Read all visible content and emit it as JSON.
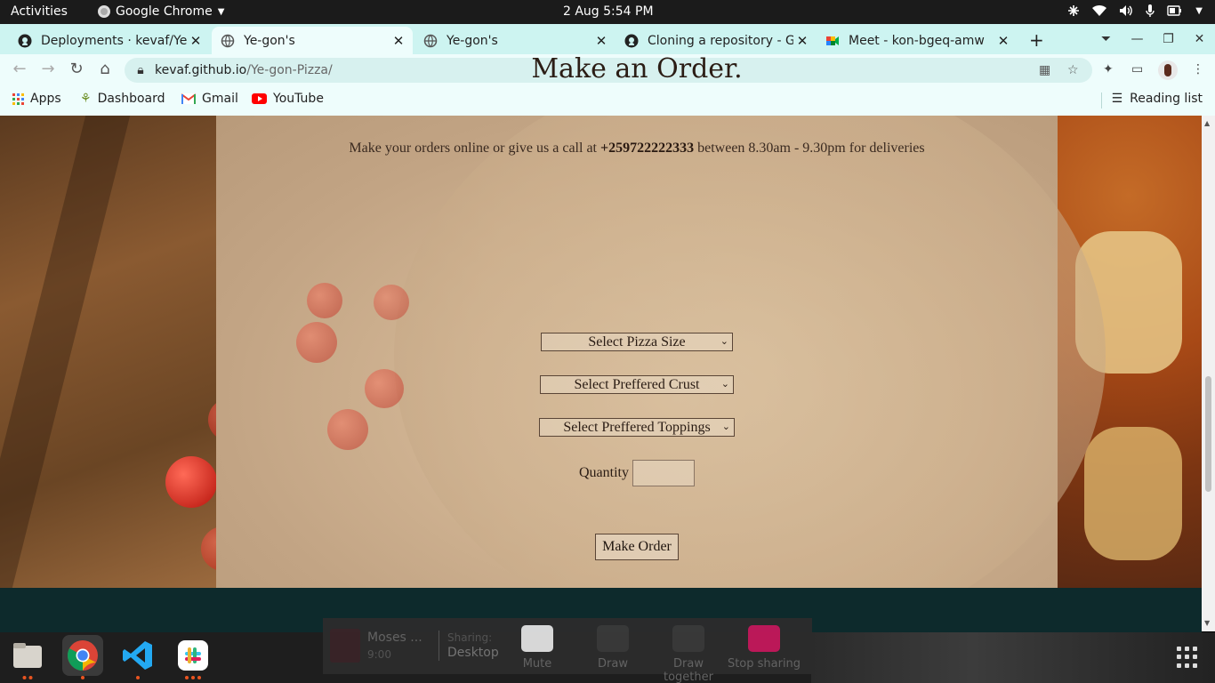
{
  "system_bar": {
    "activities": "Activities",
    "app_name": "Google Chrome",
    "clock": "2 Aug   5:54 PM"
  },
  "tabs": [
    {
      "title": "Deployments · kevaf/Ye",
      "icon": "github-icon"
    },
    {
      "title": "Ye-gon's",
      "icon": "globe-icon"
    },
    {
      "title": "Ye-gon's",
      "icon": "globe-icon"
    },
    {
      "title": "Cloning a repository - Gi",
      "icon": "github-icon"
    },
    {
      "title": "Meet - kon-bgeq-amw",
      "icon": "meet-icon"
    }
  ],
  "address_bar": {
    "host": "kevaf.github.io",
    "path": "/Ye-gon-Pizza/"
  },
  "bookmarks": {
    "apps": "Apps",
    "dashboard": "Dashboard",
    "gmail": "Gmail",
    "youtube": "YouTube",
    "reading_list": "Reading list"
  },
  "page": {
    "heading": "Make an Order.",
    "note_before": "Make your orders online or give us a call at ",
    "phone": "+259722222333",
    "note_after": " between 8.30am - 9.30pm for deliveries",
    "size_select": "Select Pizza Size",
    "crust_select": "Select Preffered Crust",
    "toppings_select": "Select Preffered Toppings",
    "quantity_label": "Quantity",
    "quantity_value": "",
    "submit_button": "Make Order"
  },
  "meet_share_bar": {
    "participant": "Moses ...",
    "time": "9:00",
    "sharing_label": "Sharing:",
    "sharing_target": "Desktop",
    "buttons": [
      "Mute",
      "Draw",
      "Draw together",
      "Stop sharing"
    ]
  },
  "colors": {
    "tab_strip": "#cdf4f1",
    "toolbar": "#eefdfc",
    "panel_overlay": "#d2b896",
    "stop_sharing": "#c2185b"
  }
}
